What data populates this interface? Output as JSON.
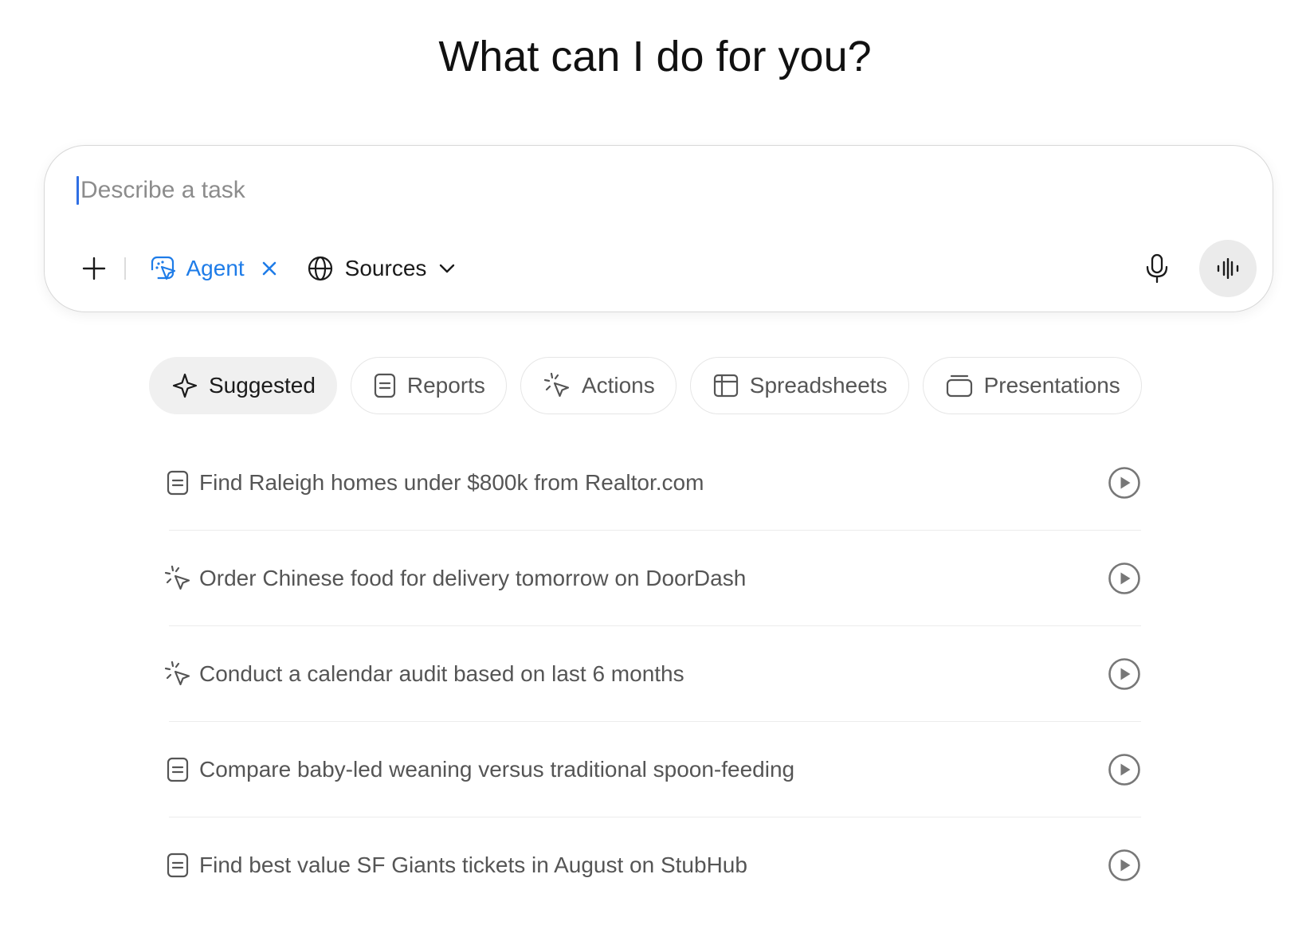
{
  "heading": "What can I do for you?",
  "task_box": {
    "placeholder": "Describe a task",
    "value": "",
    "agent_label": "Agent",
    "sources_label": "Sources"
  },
  "tabs": [
    {
      "label": "Suggested",
      "icon": "sparkle-icon",
      "active": true
    },
    {
      "label": "Reports",
      "icon": "document-icon",
      "active": false
    },
    {
      "label": "Actions",
      "icon": "cursor-click-icon",
      "active": false
    },
    {
      "label": "Spreadsheets",
      "icon": "table-icon",
      "active": false
    },
    {
      "label": "Presentations",
      "icon": "slides-icon",
      "active": false
    }
  ],
  "suggestions": [
    {
      "text": "Find Raleigh homes under $800k from Realtor.com",
      "icon": "document-icon"
    },
    {
      "text": "Order Chinese food for delivery tomorrow on DoorDash",
      "icon": "cursor-click-icon"
    },
    {
      "text": "Conduct a calendar audit based on last 6 months",
      "icon": "cursor-click-icon"
    },
    {
      "text": "Compare baby-led weaning versus traditional spoon-feeding",
      "icon": "document-icon"
    },
    {
      "text": "Find best value SF Giants tickets in August on StubHub",
      "icon": "document-icon"
    }
  ],
  "colors": {
    "accent": "#1e7ce8",
    "caret": "#2f6fe4"
  }
}
